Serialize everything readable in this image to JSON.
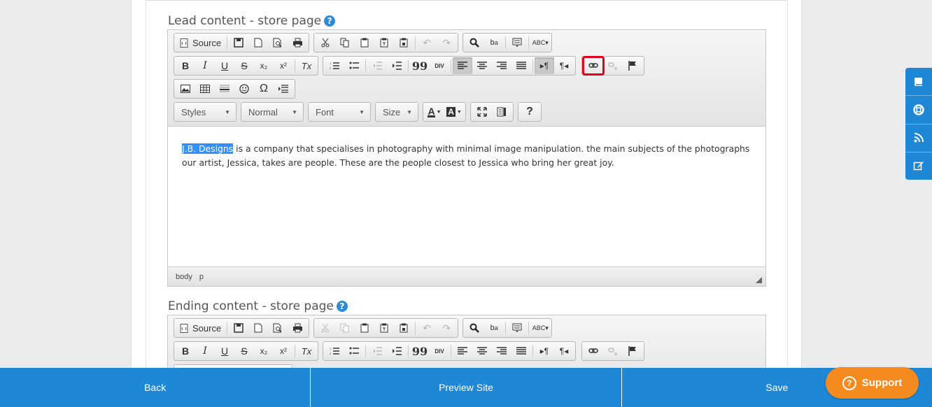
{
  "section1": {
    "label": "Lead content - store page",
    "help_icon": "?"
  },
  "section2": {
    "label": "Ending content - store page",
    "help_icon": "?"
  },
  "toolbar": {
    "source": "Source",
    "combos": {
      "styles": "Styles",
      "format": "Normal",
      "font": "Font",
      "size": "Size"
    },
    "help": "?",
    "bold": "B",
    "italic": "I",
    "underline": "U",
    "strike": "S",
    "subscript": "x₂",
    "superscript": "x²",
    "remove_format": "Tx",
    "blockquote": "99",
    "div": "DIV",
    "omega": "Ω"
  },
  "editor1": {
    "selected_text": "J.B. Designs",
    "body_text": " is a company that specialises in photography with minimal image manipulation. the main subjects of the photographs our artist, Jessica, takes are people. These are the people closest to Jessica who bring her great joy.",
    "path": [
      "body",
      "p"
    ]
  },
  "bottom": {
    "back": "Back",
    "preview": "Preview Site",
    "save": "Save"
  },
  "support": {
    "label": "Support",
    "icon": "?"
  },
  "colors": {
    "accent": "#1e88d6",
    "support": "#f58a1f",
    "highlight": "#e3001b"
  }
}
